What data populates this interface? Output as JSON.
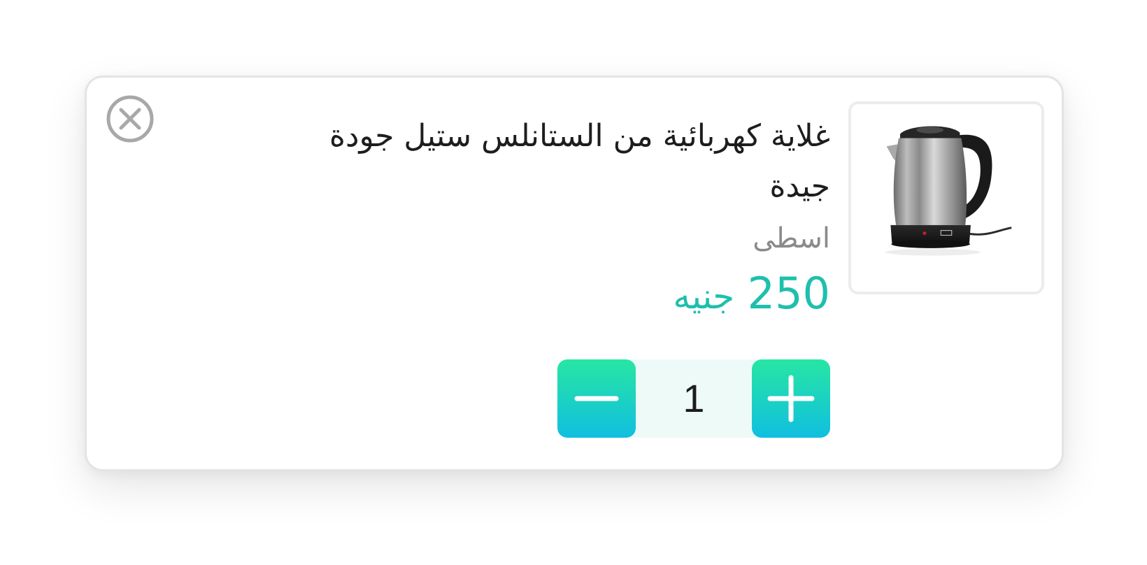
{
  "cart_item": {
    "title": "غلاية كهربائية من الستانلس ستيل جودة جيدة",
    "brand": "اسطى",
    "price_amount": "250",
    "price_currency": "جنيه",
    "quantity": "1",
    "accent_color": "#1ebfae",
    "icons": {
      "remove": "close-circle-icon",
      "decrease": "minus-icon",
      "increase": "plus-icon",
      "product": "electric-kettle-image"
    }
  }
}
